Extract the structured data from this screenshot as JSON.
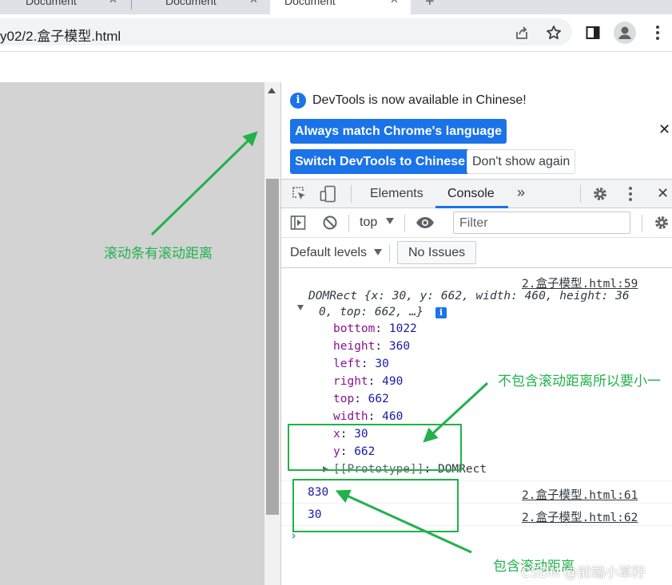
{
  "browser": {
    "tabs": [
      {
        "title": "Document",
        "active": false
      },
      {
        "title": "Document",
        "active": false
      },
      {
        "title": "Document",
        "active": true
      }
    ],
    "new_tab_symbol": "+",
    "address_bar": "y02/2.盒子模型.html",
    "icons": [
      "share-icon",
      "star-icon",
      "sidebar-icon",
      "profile-icon",
      "kebab-menu-icon"
    ]
  },
  "devtools": {
    "infobar": {
      "message": "DevTools is now available in Chinese!",
      "always_match_label": "Always match Chrome's language",
      "switch_label": "Switch DevTools to Chinese",
      "dont_show_label": "Don't show again"
    },
    "tabs": {
      "elements": "Elements",
      "console": "Console",
      "more": "»"
    },
    "filterbar": {
      "context": "top",
      "filter_placeholder": "Filter"
    },
    "levelsbar": {
      "levels": "Default levels",
      "issues": "No Issues"
    },
    "console": {
      "messages": [
        {
          "source": "2.盒子模型.html:59",
          "summary_line1": "DOMRect {x: 30, y: 662, width: 460, height: 36",
          "summary_line2": "0, top: 662, …}",
          "props": [
            {
              "key": "bottom",
              "value": "1022"
            },
            {
              "key": "height",
              "value": "360"
            },
            {
              "key": "left",
              "value": "30"
            },
            {
              "key": "right",
              "value": "490"
            },
            {
              "key": "top",
              "value": "662"
            },
            {
              "key": "width",
              "value": "460"
            },
            {
              "key": "x",
              "value": "30"
            },
            {
              "key": "y",
              "value": "662"
            }
          ],
          "prototype_key": "[[Prototype]]",
          "prototype_value": "DOMRect"
        },
        {
          "value": "830",
          "source": "2.盒子模型.html:61"
        },
        {
          "value": "30",
          "source": "2.盒子模型.html:62"
        }
      ],
      "prompt": "›"
    }
  },
  "annotations": {
    "scrollbar_note": "滚动条有滚动距离",
    "rect_note": "不包含滚动距离所以要小一",
    "scroll_note": "包含滚动距离",
    "color": "#22b14c"
  },
  "watermark": "CSDN @前端小草籽"
}
